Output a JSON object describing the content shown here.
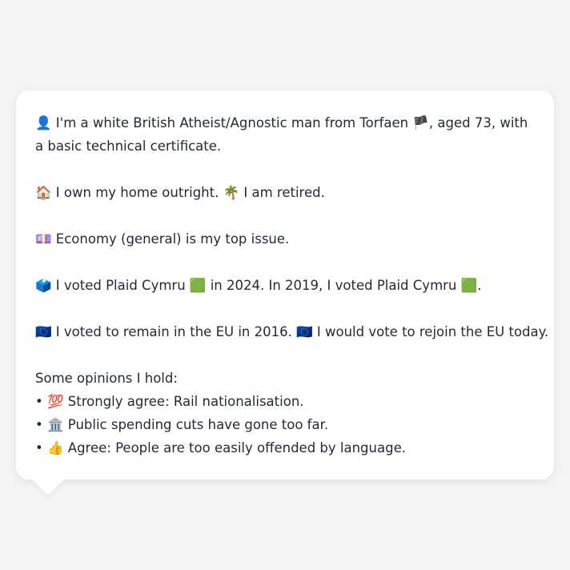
{
  "profile": {
    "identity": {
      "icon": "👤",
      "text_a": "I'm a white British Atheist/Agnostic man from Torfaen",
      "flag": "🏴",
      "text_b": ", aged 73, with a basic technical certificate."
    },
    "housing": {
      "icon_home": "🏠",
      "home_text": "I own my home outright.",
      "icon_retired": "🌴",
      "retired_text": "I am retired."
    },
    "issue": {
      "icon": "💷",
      "text": "Economy (general) is my top issue."
    },
    "vote": {
      "icon": "🗳️",
      "text_a": "I voted Plaid Cymru",
      "party_icon_1": "🟩",
      "text_b": "in 2024. In 2019, I voted Plaid Cymru",
      "party_icon_2": "🟩",
      "text_c": "."
    },
    "eu": {
      "icon_1": "🇪🇺",
      "text_a": "I voted to remain in the EU in 2016.",
      "icon_2": "🇪🇺",
      "text_b": "I would vote to rejoin the EU today."
    },
    "opinions": {
      "heading": "Some opinions I hold:",
      "bullet": "•",
      "items": [
        {
          "icon": "💯",
          "text": "Strongly agree: Rail nationalisation."
        },
        {
          "icon": "🏛️",
          "text": "Public spending cuts have gone too far."
        },
        {
          "icon": "👍",
          "text": "Agree: People are too easily offended by language."
        }
      ]
    }
  }
}
